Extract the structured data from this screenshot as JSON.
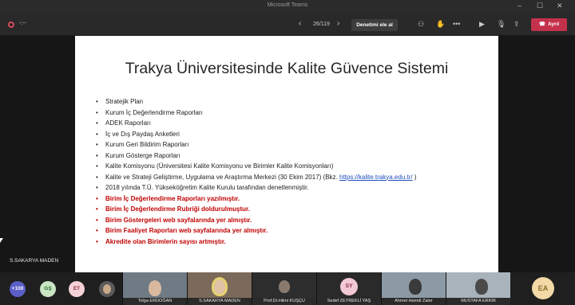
{
  "window": {
    "title": "Microsoft Teams"
  },
  "toolbar": {
    "timer": "-:--",
    "page_indicator": "26/119",
    "take_control_label": "Denetimi ele al",
    "leave_label": "Ayrıl"
  },
  "slide": {
    "title": "Trakya Üniversitesinde Kalite Güvence Sistemi",
    "bullets": [
      "Stratejik Plan",
      "Kurum İç Değerlendirme Raporları",
      "ADEK Raporları",
      "İç ve Dış Paydaş Anketleri",
      "Kurum Geri Bildirim Raporları",
      "Kurum Gösterge Raporları",
      "Kalite Komisyonu (Üniversitesi Kalite Komisyonu ve Birimler Kalite Komisyonları)",
      "Kalite ve Strateji Geliştirme, Uygulama ve Araştırma Merkezi (30 Ekim 2017) (Bkz.",
      "2018 yılında T.Ü. Yükseköğretim Kalite Kurulu tarafından denetlenmiştir."
    ],
    "link_text": "https://kalite.trakya.edu.tr/",
    "link_suffix": " )",
    "red_bullets": [
      "Birim İç Değerlendirme Raporları yazılmıştır.",
      "Birim İç Değerlendirme Rubriği doldurulmuştur.",
      "Birim Göstergeleri web sayfalarında yer almıştır.",
      "Birim Faaliyet Raporları web sayfalarında yer almıştır.",
      "Akredite olan Birimlerin sayısı artmıştır."
    ]
  },
  "presenter": "S.SAKARYA MADEN",
  "gallery": {
    "more_count": "+100",
    "chips": [
      "GŞ",
      "ET"
    ],
    "tiles": [
      {
        "name": "Tolga ERDOĞAN"
      },
      {
        "name": "S.SAKARYA MADEN"
      },
      {
        "name": "Prof.Dr.Hilmi KUŞÇU"
      },
      {
        "name": "Sedef ZEYREKLİ YAŞ",
        "initials": "SY"
      },
      {
        "name": "Ahmet Hamdi Zater"
      },
      {
        "name": "MUSTAFA ERKIR"
      }
    ],
    "self_initials": "EA"
  },
  "colors": {
    "leave": "#c4314b",
    "accent_red_text": "#c00000",
    "link": "#1f4fbf"
  }
}
